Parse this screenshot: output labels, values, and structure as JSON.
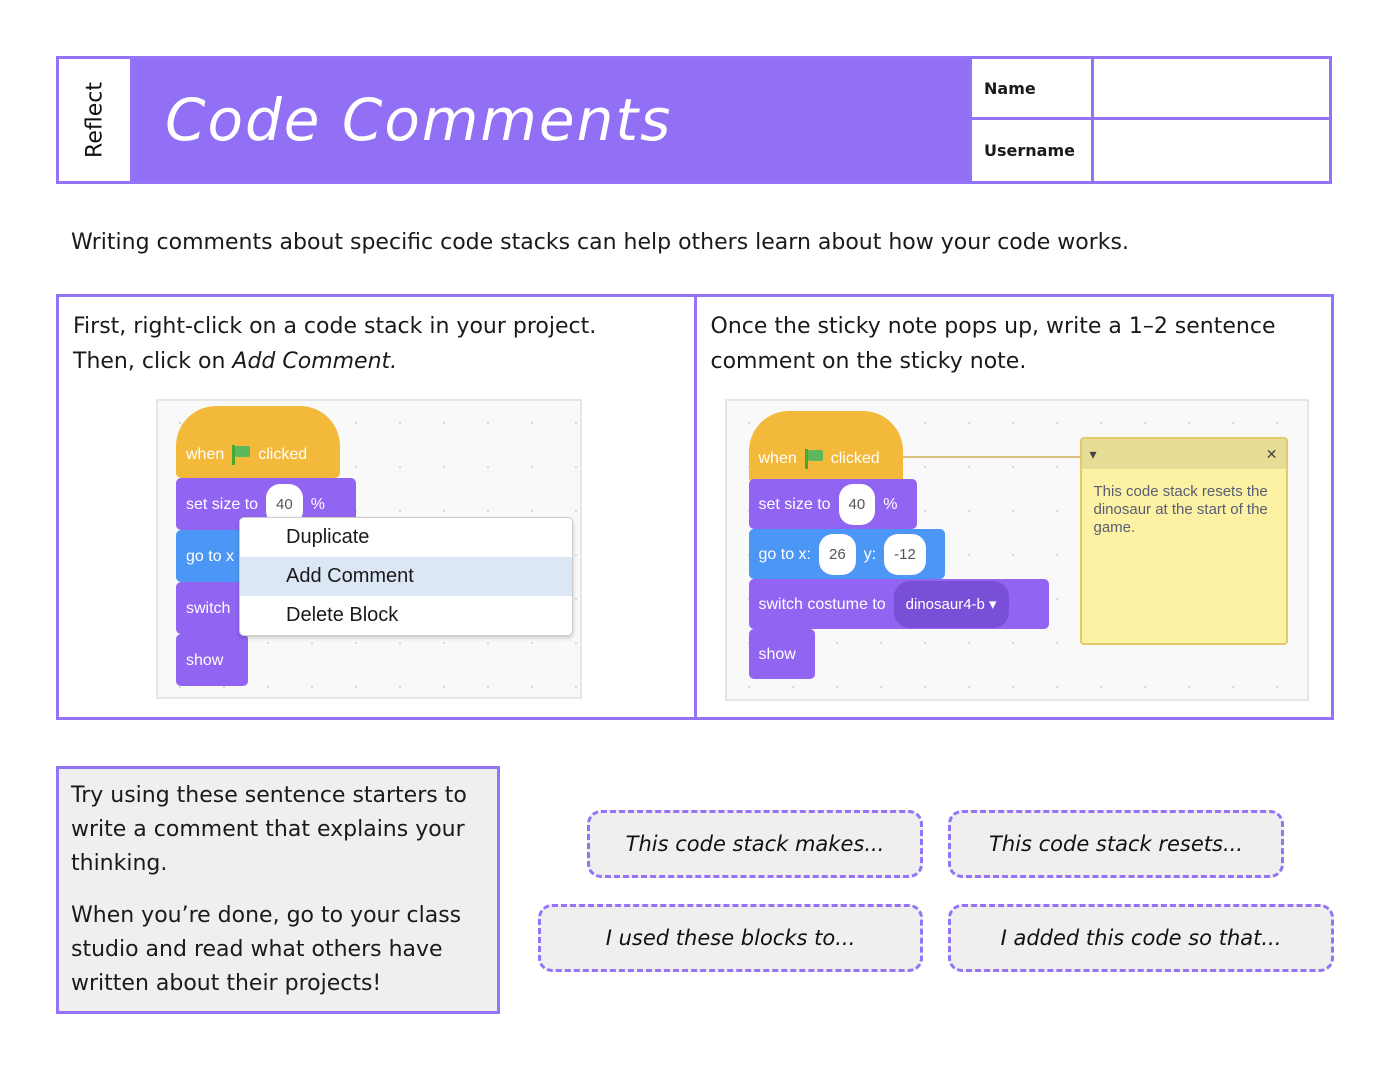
{
  "header": {
    "category": "Reflect",
    "title": "Code Comments",
    "fields": [
      {
        "label": "Name",
        "value": ""
      },
      {
        "label": "Username",
        "value": ""
      }
    ]
  },
  "intro": "Writing comments about specific code stacks can help others learn about how your code works.",
  "steps": [
    {
      "text_line1": "First, right-click on a code stack in your project.",
      "text_line2_prefix": "Then, click on ",
      "text_line2_em": "Add Comment.",
      "blocks": {
        "when": "when",
        "clicked": "clicked",
        "set_size": "set size to",
        "size_value": "40",
        "percent": "%",
        "goto": "go to x",
        "switch": "switch",
        "show": "show"
      },
      "context_menu": [
        "Duplicate",
        "Add Comment",
        "Delete Block"
      ],
      "highlighted_item": "Add Comment"
    },
    {
      "text": "Once the sticky note pops up, write a 1–2 sentence comment on the sticky note.",
      "blocks": {
        "when": "when",
        "clicked": "clicked",
        "set_size": "set size to",
        "size_value": "40",
        "percent": "%",
        "goto_x": "go to x:",
        "x_value": "26",
        "goto_y": "y:",
        "y_value": "-12",
        "switch": "switch costume to",
        "costume": "dinosaur4-b",
        "show": "show"
      },
      "comment": {
        "collapse_icon": "▾",
        "close_icon": "✕",
        "text": "This code stack resets the dinosaur at the start of the game."
      }
    }
  ],
  "tip": {
    "paragraphs": [
      "Try using these sentence starters to write a comment that explains your thinking.",
      "When you’re done, go to your class studio and read what others have written about their projects!"
    ]
  },
  "sentence_starters": [
    "This code stack makes...",
    "This code stack resets...",
    "I used these blocks to...",
    "I added this code so that..."
  ]
}
